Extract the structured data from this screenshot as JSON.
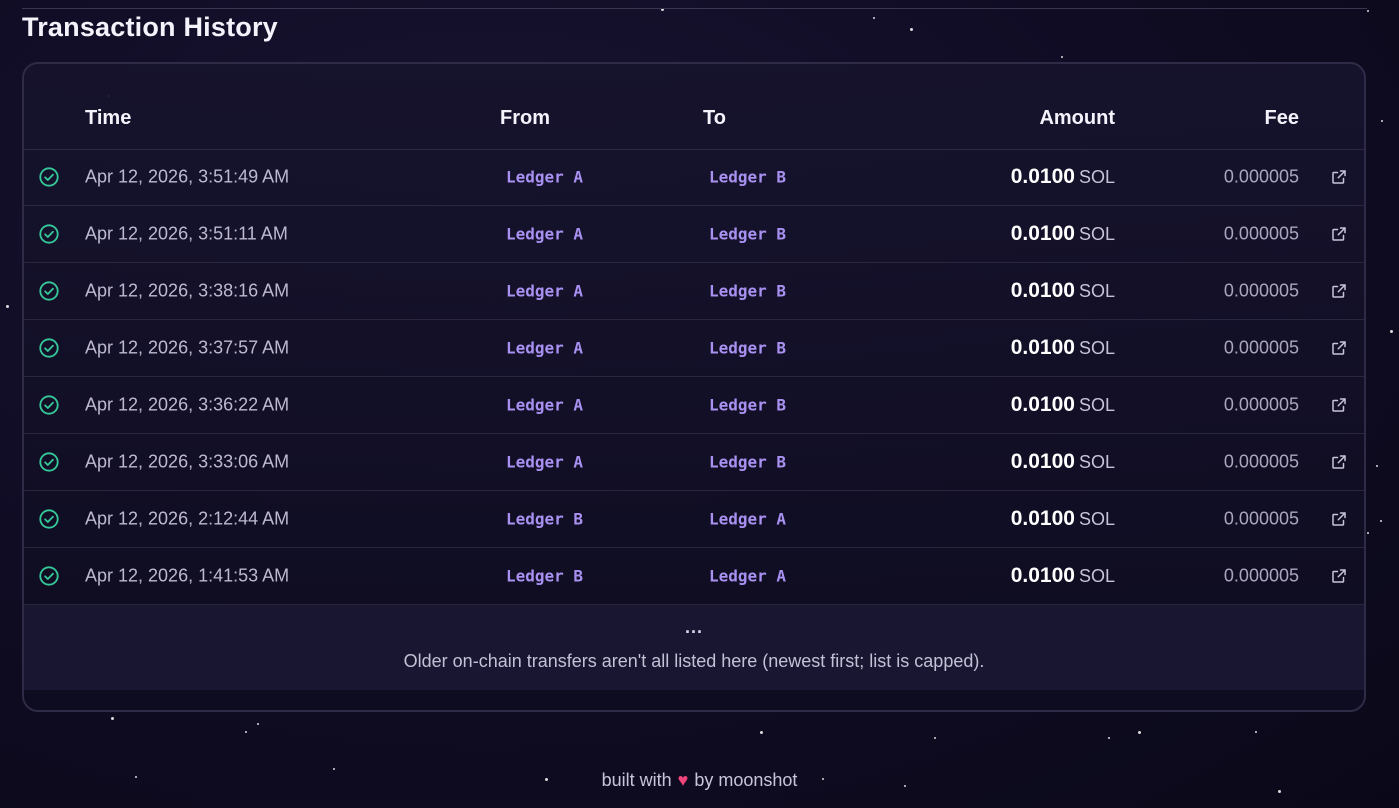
{
  "title": "Transaction History",
  "columns": {
    "time": "Time",
    "from": "From",
    "to": "To",
    "amount": "Amount",
    "fee": "Fee"
  },
  "colors": {
    "accent": "#a991f2",
    "success": "#35c99a",
    "heart": "#f0457a"
  },
  "icons": {
    "status": "check-circle-icon",
    "link": "external-link-icon",
    "heart": "heart-icon"
  },
  "transactions": [
    {
      "time": "Apr 12, 2026, 3:51:49 AM",
      "from": "Ledger A",
      "to": "Ledger B",
      "amount": "0.0100",
      "unit": "SOL",
      "fee": "0.000005"
    },
    {
      "time": "Apr 12, 2026, 3:51:11 AM",
      "from": "Ledger A",
      "to": "Ledger B",
      "amount": "0.0100",
      "unit": "SOL",
      "fee": "0.000005"
    },
    {
      "time": "Apr 12, 2026, 3:38:16 AM",
      "from": "Ledger A",
      "to": "Ledger B",
      "amount": "0.0100",
      "unit": "SOL",
      "fee": "0.000005"
    },
    {
      "time": "Apr 12, 2026, 3:37:57 AM",
      "from": "Ledger A",
      "to": "Ledger B",
      "amount": "0.0100",
      "unit": "SOL",
      "fee": "0.000005"
    },
    {
      "time": "Apr 12, 2026, 3:36:22 AM",
      "from": "Ledger A",
      "to": "Ledger B",
      "amount": "0.0100",
      "unit": "SOL",
      "fee": "0.000005"
    },
    {
      "time": "Apr 12, 2026, 3:33:06 AM",
      "from": "Ledger A",
      "to": "Ledger B",
      "amount": "0.0100",
      "unit": "SOL",
      "fee": "0.000005"
    },
    {
      "time": "Apr 12, 2026, 2:12:44 AM",
      "from": "Ledger B",
      "to": "Ledger A",
      "amount": "0.0100",
      "unit": "SOL",
      "fee": "0.000005"
    },
    {
      "time": "Apr 12, 2026, 1:41:53 AM",
      "from": "Ledger B",
      "to": "Ledger A",
      "amount": "0.0100",
      "unit": "SOL",
      "fee": "0.000005"
    }
  ],
  "list_footer": {
    "ellipsis": "...",
    "note": "Older on-chain transfers aren't all listed here (newest first; list is capped)."
  },
  "footer": {
    "prefix": "built with",
    "heart": "♥",
    "suffix": "by moonshot"
  }
}
